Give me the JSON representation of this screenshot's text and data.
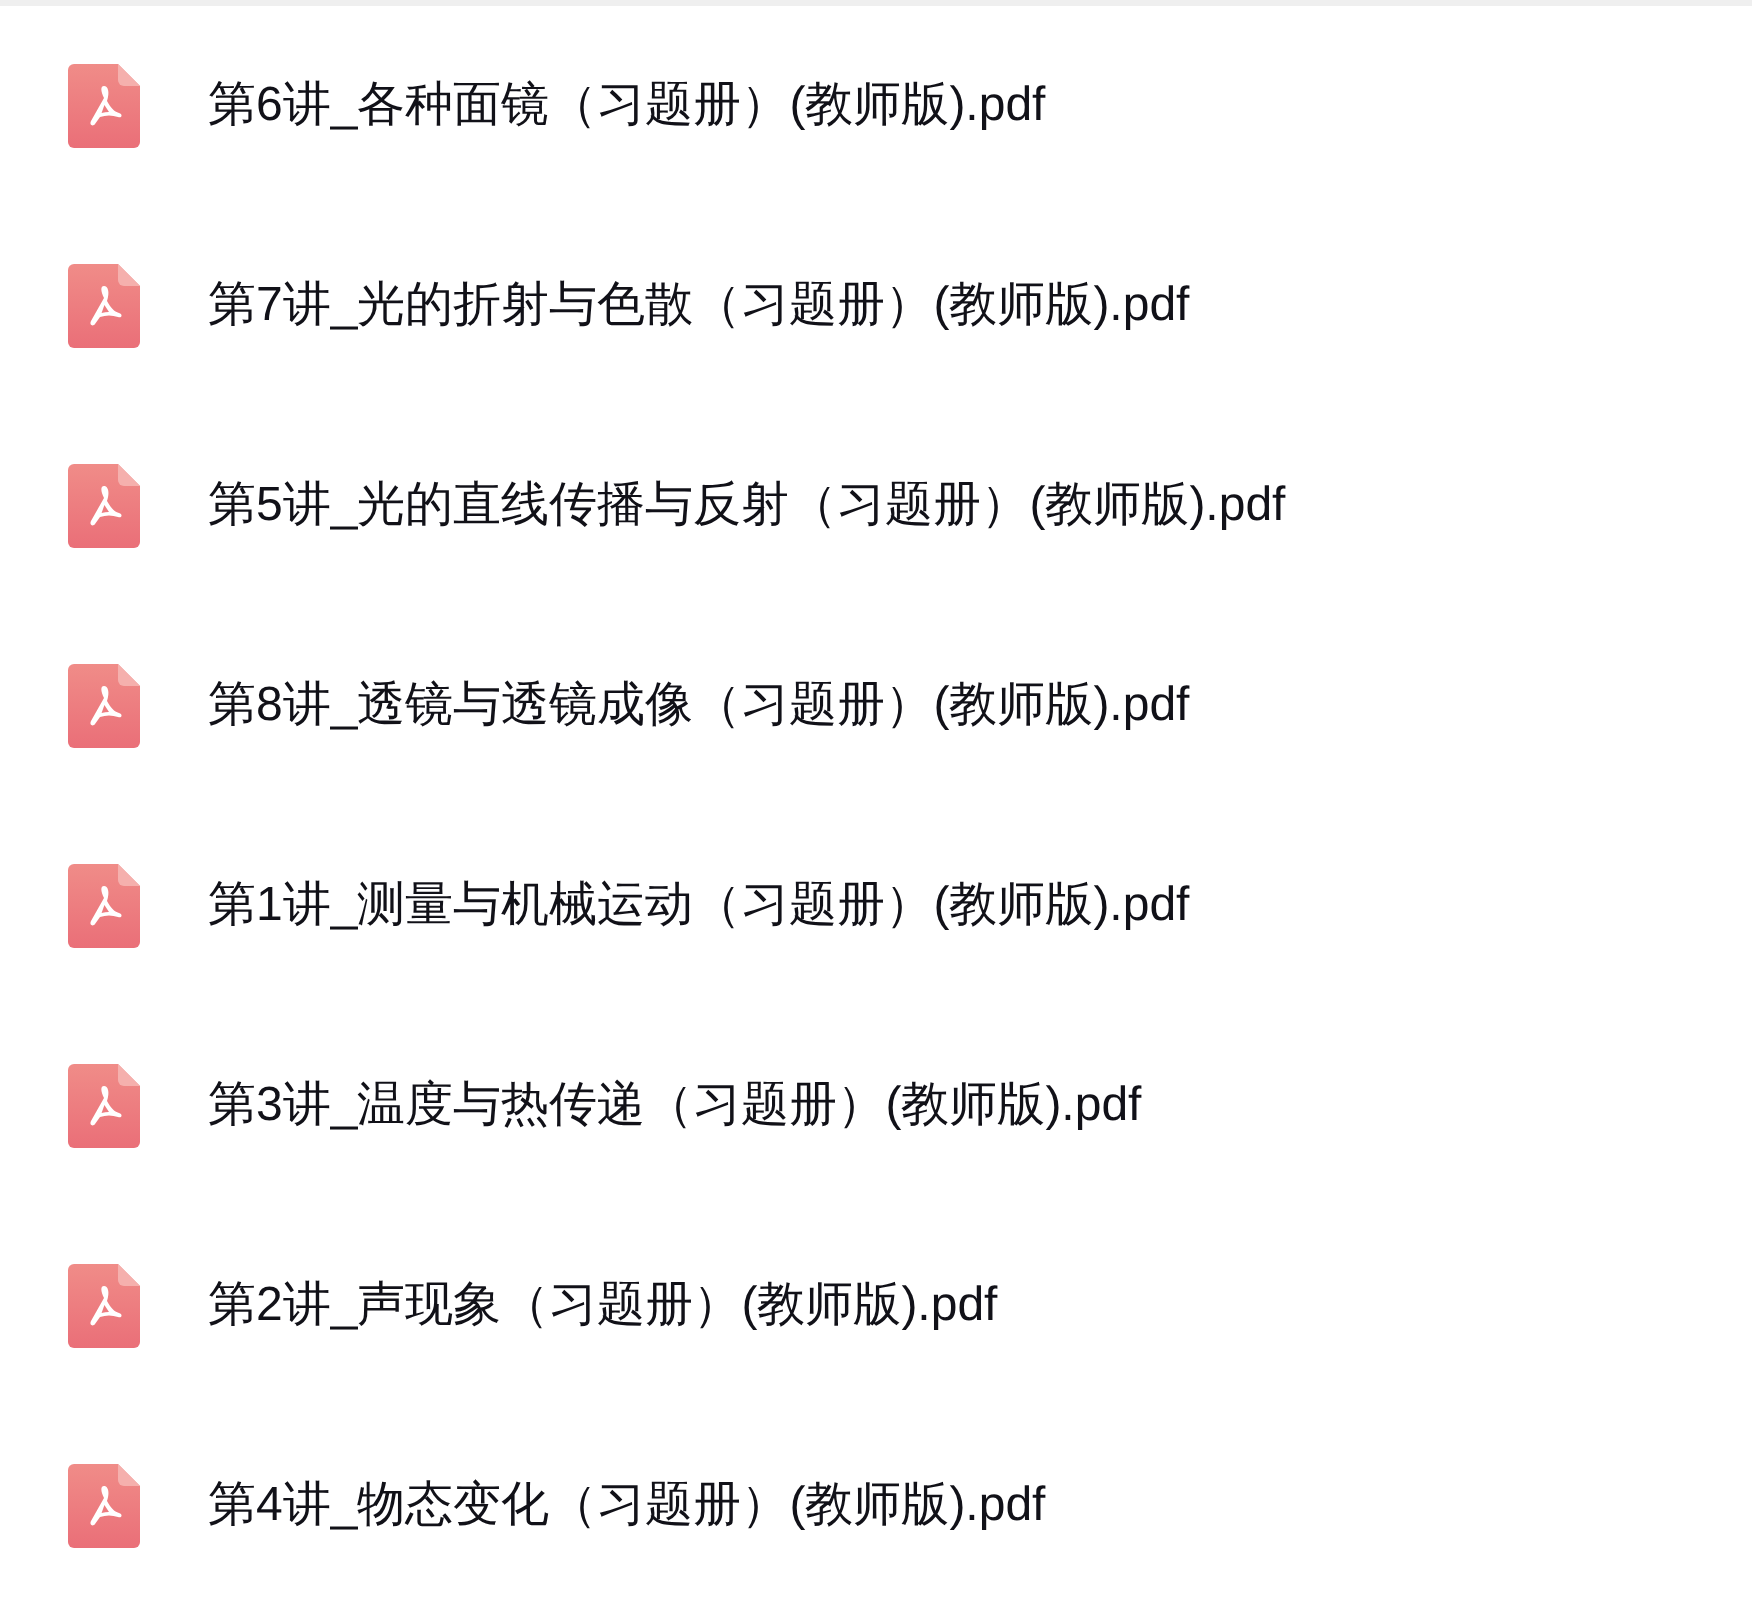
{
  "files": [
    {
      "name": "第6讲_各种面镜（习题册）(教师版).pdf"
    },
    {
      "name": "第7讲_光的折射与色散（习题册）(教师版).pdf"
    },
    {
      "name": "第5讲_光的直线传播与反射（习题册）(教师版).pdf"
    },
    {
      "name": "第8讲_透镜与透镜成像（习题册）(教师版).pdf"
    },
    {
      "name": "第1讲_测量与机械运动（习题册）(教师版).pdf"
    },
    {
      "name": "第3讲_温度与热传递（习题册）(教师版).pdf"
    },
    {
      "name": "第2讲_声现象（习题册）(教师版).pdf"
    },
    {
      "name": "第4讲_物态变化（习题册）(教师版).pdf"
    }
  ]
}
